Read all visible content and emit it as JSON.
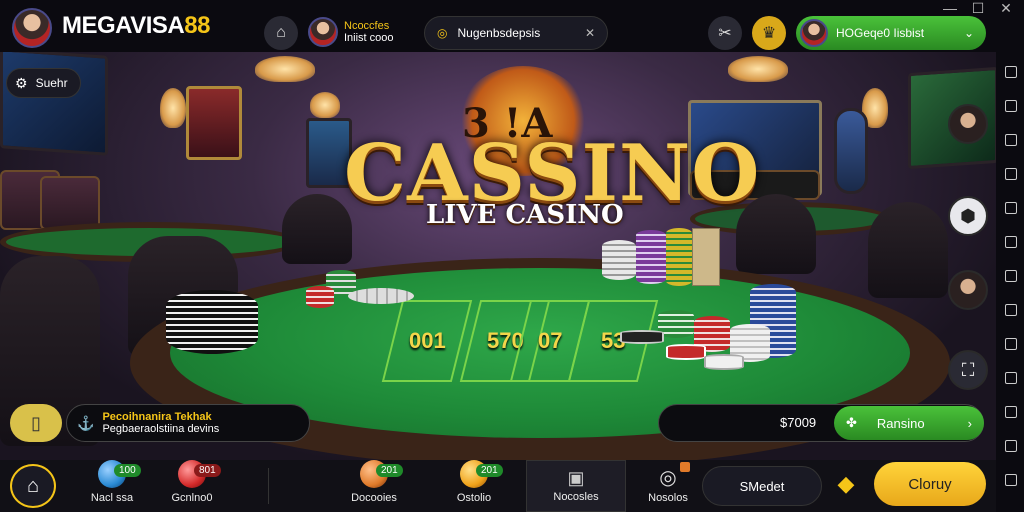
{
  "header": {
    "brand_main": "MEGAVISA",
    "brand_num": "88",
    "user_line1": "Ncoccfes",
    "user_line2": "Iniist cooo",
    "search_text": "Nugenbsdepsis",
    "account_text": "HOGeqe0 Iisbist"
  },
  "scene": {
    "top_left_chip": "Suehr",
    "logo_sub": "3 !A",
    "logo_main": "CASSINO",
    "logo_tag": "LIVE CASINO",
    "bet_labels": [
      "001",
      "570",
      "07",
      "53"
    ]
  },
  "notice": {
    "line1": "Pecoihnanira Tekhak",
    "line2": "Pegbaeraolstiina devins"
  },
  "balance": {
    "amount": "$7009",
    "action_label": "Ransino"
  },
  "bottom_nav": [
    {
      "label": "Nacl ssa",
      "badge": "100",
      "color": "#2a8ad4"
    },
    {
      "label": "Gcnlno0",
      "badge": "801",
      "color": "#d42a2a"
    },
    {
      "label": "Docooies",
      "badge": "201",
      "color": "#e07a2a"
    },
    {
      "label": "Ostolio",
      "badge": "201",
      "color": "#f0a21a"
    },
    {
      "label": "Nocosles",
      "badge": "",
      "color": "#888888"
    },
    {
      "label": "Nosolos",
      "badge": "",
      "color": "#cccccc"
    }
  ],
  "bottom_actions": {
    "menu_label": "SMedet",
    "primary_label": "Cloruy"
  },
  "colors": {
    "accent_yellow": "#f5c518",
    "accent_green": "#3fae2a"
  }
}
